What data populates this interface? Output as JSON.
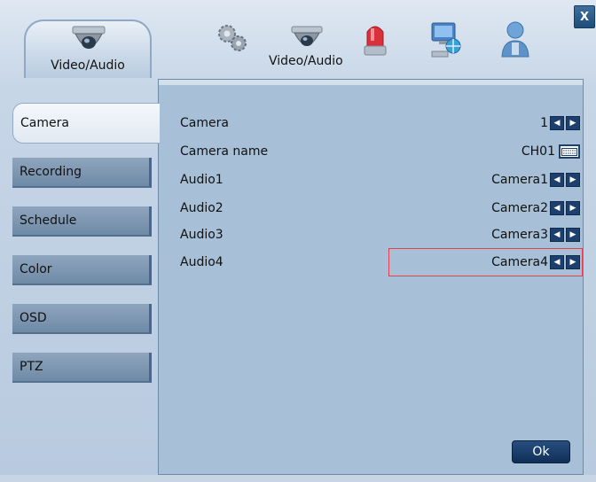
{
  "window": {
    "close_label": "X"
  },
  "top_tabs": {
    "active_label": "Video/Audio",
    "secondary_label": "Video/Audio",
    "icons": [
      "dome-camera-icon",
      "gears-icon",
      "dome-camera-icon",
      "alarm-siren-icon",
      "network-icon",
      "user-icon"
    ]
  },
  "sidebar": {
    "items": [
      {
        "label": "Camera",
        "active": true
      },
      {
        "label": "Recording",
        "active": false
      },
      {
        "label": "Schedule",
        "active": false
      },
      {
        "label": "Color",
        "active": false
      },
      {
        "label": "OSD",
        "active": false
      },
      {
        "label": "PTZ",
        "active": false
      }
    ]
  },
  "settings": [
    {
      "label": "Camera",
      "value": "1",
      "control": "arrows"
    },
    {
      "label": "Camera name",
      "value": "CH01",
      "control": "keyboard"
    },
    {
      "label": "Audio1",
      "value": "Camera1",
      "control": "arrows"
    },
    {
      "label": "Audio2",
      "value": "Camera2",
      "control": "arrows"
    },
    {
      "label": "Audio3",
      "value": "Camera3",
      "control": "arrows"
    },
    {
      "label": "Audio4",
      "value": "Camera4",
      "control": "arrows",
      "selected": true
    }
  ],
  "ok_label": "Ok",
  "colors": {
    "accent": "#1c3f6e",
    "selection_border": "#e0404f",
    "panel": "#a7bfd7"
  }
}
